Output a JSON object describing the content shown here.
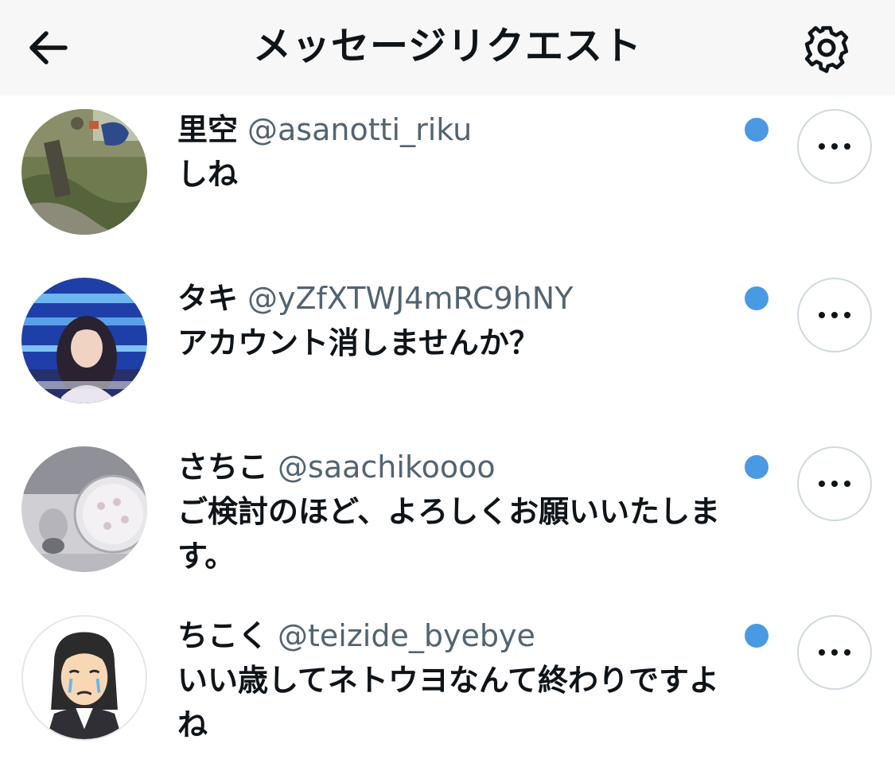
{
  "header": {
    "title": "メッセージリクエスト",
    "back_icon": "arrow-left-icon",
    "settings_icon": "gear-icon"
  },
  "requests": [
    {
      "name": "里空",
      "handle": "@asanotti_riku",
      "message": "しね",
      "unread": true,
      "avatar": "photo-avatar"
    },
    {
      "name": "タキ",
      "handle": "@yZfXTWJ4mRC9hNY",
      "message": "アカウント消しませんか？",
      "unread": true,
      "avatar": "photo-avatar"
    },
    {
      "name": "さちこ",
      "handle": "@saachikoooo",
      "message": "ご検討のほど、よろしくお願いいたします。",
      "unread": true,
      "avatar": "photo-avatar"
    },
    {
      "name": "ちこく",
      "handle": "@teizide_byebye",
      "message": "いい歳してネトウヨなんて終わりですよね",
      "unread": true,
      "avatar": "illustration-avatar"
    }
  ],
  "colors": {
    "unread_dot": "#4a9ae3",
    "handle_gray": "#536471",
    "header_bg": "#f7f7f7"
  }
}
